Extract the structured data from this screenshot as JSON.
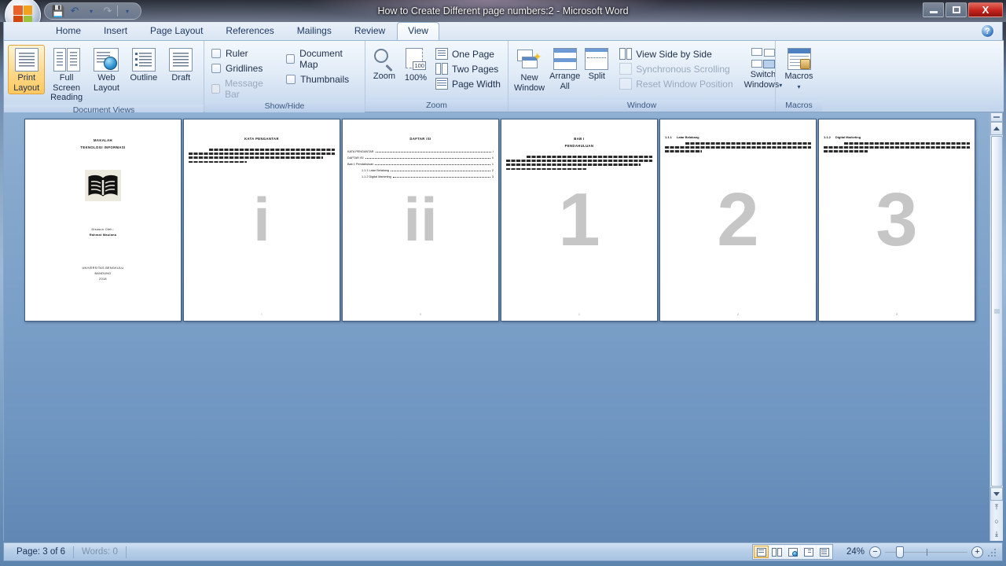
{
  "window": {
    "title": "How to Create Different page numbers:2 - Microsoft Word",
    "minimize_label": "Minimize",
    "maximize_label": "Maximize",
    "close_label": "X"
  },
  "quick_access": {
    "office_button_label": "Office Button",
    "items": [
      {
        "name": "save-icon",
        "glyph": "💾",
        "label": "Save"
      },
      {
        "name": "undo-icon",
        "glyph": "↶",
        "label": "Undo"
      },
      {
        "name": "undo-dropdown-icon",
        "glyph": "▾",
        "label": "Undo options"
      },
      {
        "name": "redo-icon",
        "glyph": "↷",
        "label": "Redo"
      },
      {
        "name": "customize-qat-icon",
        "glyph": "▾",
        "label": "Customize Quick Access Toolbar"
      }
    ]
  },
  "tabs": [
    {
      "label": "Home",
      "active": false
    },
    {
      "label": "Insert",
      "active": false
    },
    {
      "label": "Page Layout",
      "active": false
    },
    {
      "label": "References",
      "active": false
    },
    {
      "label": "Mailings",
      "active": false
    },
    {
      "label": "Review",
      "active": false
    },
    {
      "label": "View",
      "active": true
    }
  ],
  "help_button": "?",
  "ribbon": {
    "groups": [
      {
        "name": "document-views",
        "label": "Document Views",
        "buttons": [
          {
            "label_line1": "Print",
            "label_line2": "Layout",
            "selected": true
          },
          {
            "label_line1": "Full Screen",
            "label_line2": "Reading",
            "selected": false
          },
          {
            "label_line1": "Web",
            "label_line2": "Layout",
            "selected": false
          },
          {
            "label_line1": "Outline",
            "label_line2": "",
            "selected": false
          },
          {
            "label_line1": "Draft",
            "label_line2": "",
            "selected": false
          }
        ]
      },
      {
        "name": "show-hide",
        "label": "Show/Hide",
        "column1": [
          {
            "label": "Ruler",
            "checked": false,
            "disabled": false
          },
          {
            "label": "Gridlines",
            "checked": false,
            "disabled": false
          },
          {
            "label": "Message Bar",
            "checked": false,
            "disabled": true
          }
        ],
        "column2": [
          {
            "label": "Document Map",
            "checked": false,
            "disabled": false
          },
          {
            "label": "Thumbnails",
            "checked": false,
            "disabled": false
          }
        ]
      },
      {
        "name": "zoom",
        "label": "Zoom",
        "big_buttons": [
          {
            "label_line1": "Zoom",
            "label_line2": ""
          },
          {
            "label_line1": "100%",
            "label_line2": "",
            "badge": "100"
          }
        ],
        "commands": [
          {
            "label": "One Page",
            "disabled": false
          },
          {
            "label": "Two Pages",
            "disabled": false
          },
          {
            "label": "Page Width",
            "disabled": false
          }
        ]
      },
      {
        "name": "window",
        "label": "Window",
        "big_buttons": [
          {
            "label_line1": "New",
            "label_line2": "Window"
          },
          {
            "label_line1": "Arrange",
            "label_line2": "All"
          },
          {
            "label_line1": "Split",
            "label_line2": ""
          }
        ],
        "commands": [
          {
            "label": "View Side by Side",
            "disabled": false
          },
          {
            "label": "Synchronous Scrolling",
            "disabled": true
          },
          {
            "label": "Reset Window Position",
            "disabled": true
          }
        ],
        "switch_windows": {
          "label_line1": "Switch",
          "label_line2": "Windows",
          "caret": "▾"
        }
      },
      {
        "name": "macros",
        "label": "Macros",
        "macros_button": {
          "label_line1": "Macros",
          "label_line2": "",
          "caret": "▾"
        }
      }
    ]
  },
  "document": {
    "pages": [
      {
        "number": 1,
        "kind": "cover",
        "title_line1": "MAKALAH",
        "title_line2": "TEKNOLOGI INFORMASI",
        "book_glyph": "📖",
        "author_label": "Disusun Oleh :",
        "author_name": "Rahmat Maulana",
        "institution_line1": "UNIVERSITAS BENGKULU",
        "institution_line2": "BANDUNG",
        "institution_line3": "2018",
        "watermark": "",
        "footer": ""
      },
      {
        "number": 2,
        "kind": "text",
        "heading": "KATA PENGANTAR",
        "watermark": "i",
        "watermark_style": "roman",
        "footer": "i"
      },
      {
        "number": 3,
        "kind": "toc",
        "heading": "DAFTAR ISI",
        "toc_entries": [
          {
            "text": "KATA PENGANTAR",
            "page": "i",
            "level": 1
          },
          {
            "text": "DAFTAR ISI",
            "page": "ii",
            "level": 1
          },
          {
            "text": "Bab 1          Pendahuluan",
            "page": "1",
            "level": 1
          },
          {
            "text": "1.1.1   Latar Belakang",
            "page": "2",
            "level": 2
          },
          {
            "text": "1.1.2   Digital Marketing",
            "page": "3",
            "level": 2
          }
        ],
        "watermark": "ii",
        "watermark_style": "roman",
        "footer": "ii"
      },
      {
        "number": 4,
        "kind": "chapter",
        "heading": "BAB I",
        "subheading": "PENDAHULUAN",
        "watermark": "1",
        "watermark_style": "arabic",
        "footer": "1"
      },
      {
        "number": 5,
        "kind": "section",
        "heading_number": "1.1.1",
        "heading": "Latar Belakang",
        "watermark": "2",
        "watermark_style": "arabic",
        "footer": "2"
      },
      {
        "number": 6,
        "kind": "section",
        "heading_number": "1.1.2",
        "heading": "Digital Marketing",
        "watermark": "3",
        "watermark_style": "arabic",
        "footer": "3"
      }
    ]
  },
  "scrollbar": {
    "up_label": "Scroll up",
    "down_label": "Scroll down",
    "previous_page_glyph": "⤒",
    "select_object_glyph": "○",
    "next_page_glyph": "⤓"
  },
  "statusbar": {
    "page_info": "Page: 3 of 6",
    "word_count": "Words: 0",
    "zoom_percent": "24%",
    "zoom_out_glyph": "−",
    "zoom_in_glyph": "+",
    "view_buttons": [
      {
        "name": "print-layout-view-button",
        "label": "Print Layout",
        "active": true
      },
      {
        "name": "full-screen-reading-view-button",
        "label": "Full Screen Reading",
        "active": false
      },
      {
        "name": "web-layout-view-button",
        "label": "Web Layout",
        "active": false
      },
      {
        "name": "outline-view-button",
        "label": "Outline",
        "active": false
      },
      {
        "name": "draft-view-button",
        "label": "Draft",
        "active": false
      }
    ]
  },
  "colors": {
    "accent": "#ffd98a",
    "titlebar": "#3b4250",
    "ribbon": "#e3edf8",
    "workspace": "#7ba0c8",
    "close_button": "#c6231c"
  }
}
